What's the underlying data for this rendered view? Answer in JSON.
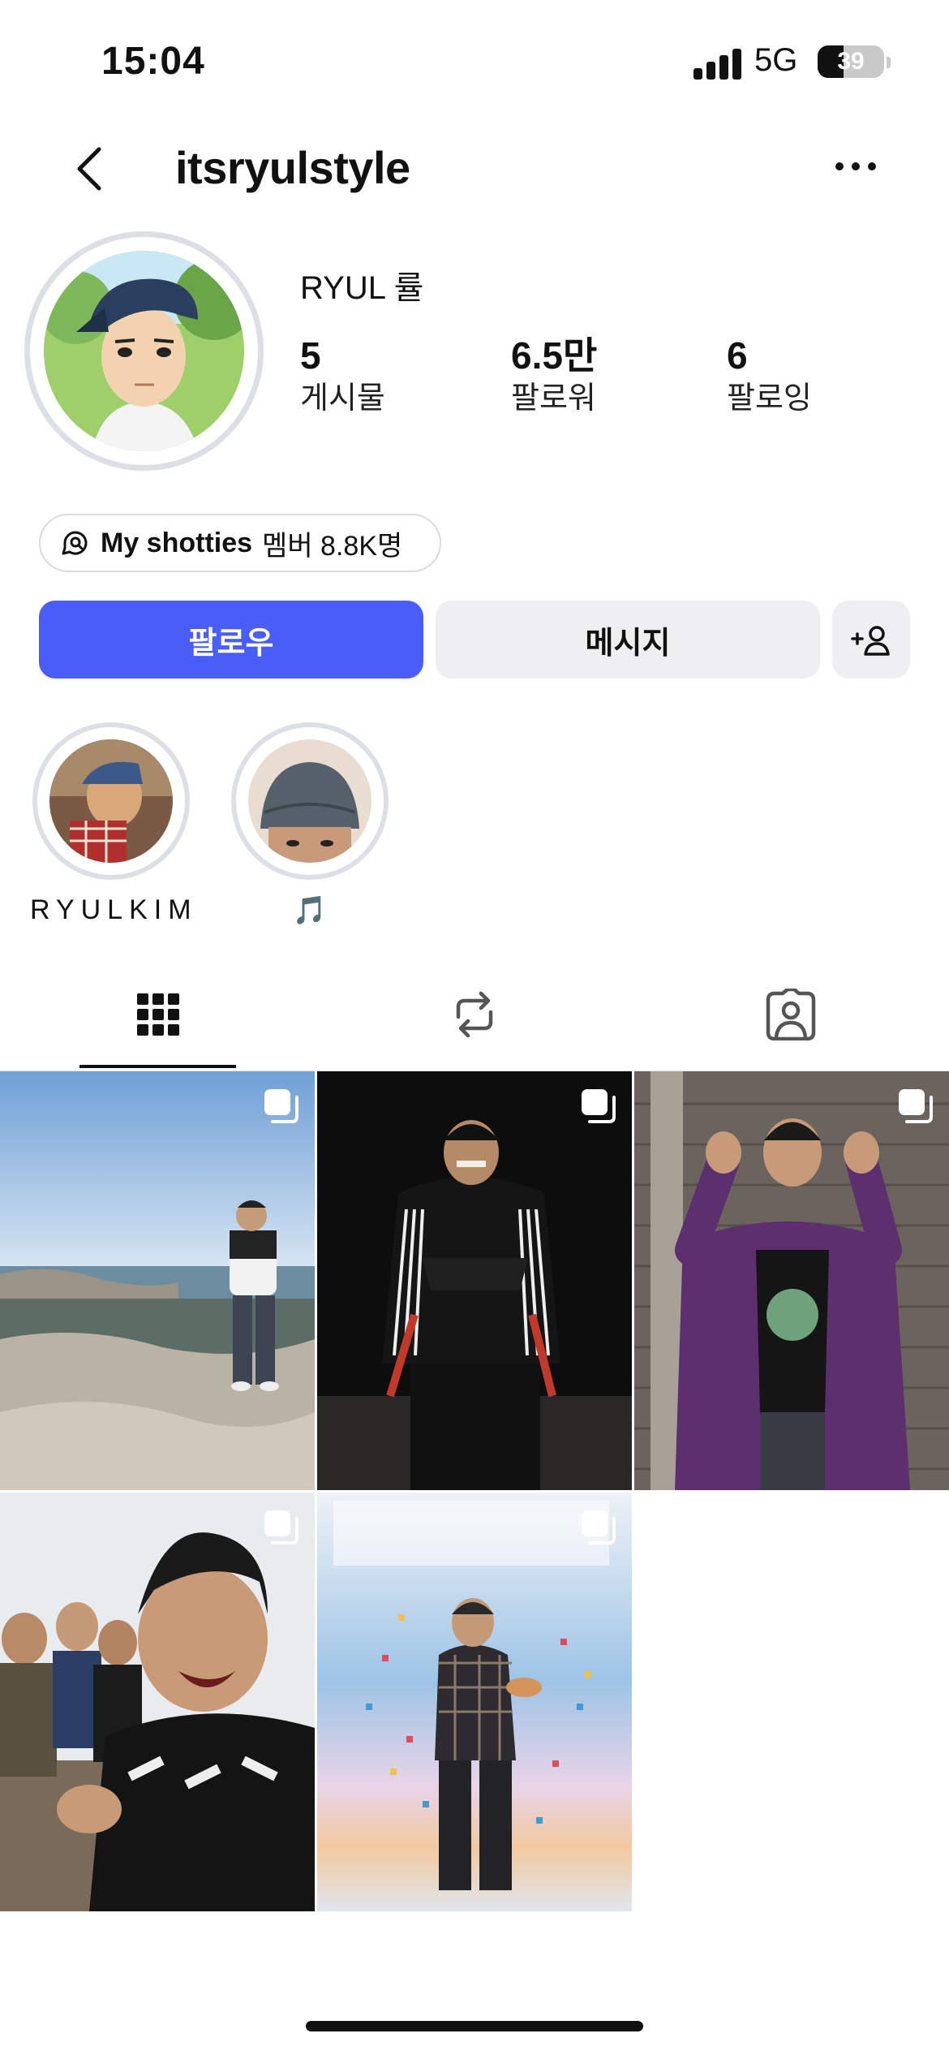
{
  "status_bar": {
    "time": "15:04",
    "network": "5G",
    "battery": "39",
    "battery_level": 0.39
  },
  "header": {
    "username": "itsryulstyle",
    "back_icon": "chevron-left-icon",
    "more_icon": "ellipsis-icon"
  },
  "profile": {
    "display_name": "RYUL 률",
    "stats": [
      {
        "value": "5",
        "label": "게시물"
      },
      {
        "value": "6.5만",
        "label": "팔로워"
      },
      {
        "value": "6",
        "label": "팔로잉"
      }
    ]
  },
  "channel": {
    "name": "My shotties",
    "members": "멤버 8.8K명",
    "icon": "broadcast-channel-icon"
  },
  "actions": {
    "follow_label": "팔로우",
    "message_label": "메시지",
    "add_user_icon": "add-user-icon",
    "follow_color": "#4a5df9"
  },
  "highlights": [
    {
      "label": "RYULKIM"
    },
    {
      "label": "🎵"
    }
  ],
  "tabs": [
    {
      "name": "posts",
      "icon": "grid-icon",
      "active": true
    },
    {
      "name": "reposts",
      "icon": "repost-icon",
      "active": false
    },
    {
      "name": "tagged",
      "icon": "tagged-user-icon",
      "active": false
    }
  ],
  "posts": [
    {
      "type": "carousel"
    },
    {
      "type": "carousel"
    },
    {
      "type": "carousel"
    },
    {
      "type": "carousel"
    },
    {
      "type": "carousel"
    }
  ]
}
